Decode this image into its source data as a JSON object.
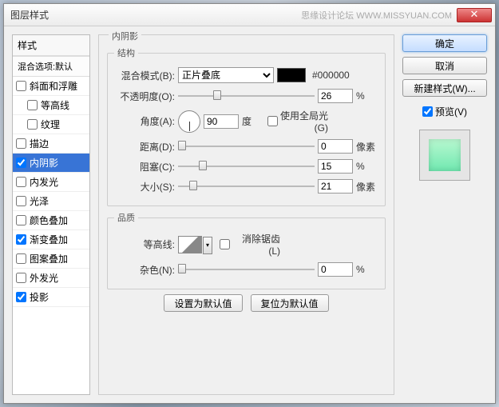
{
  "titlebar": {
    "title": "图层样式",
    "watermark": "思缘设计论坛  WWW.MISSYUAN.COM"
  },
  "sidebar": {
    "header": "样式",
    "blend_defaults": "混合选项:默认",
    "items": [
      {
        "label": "斜面和浮雕",
        "checked": false,
        "indent": false,
        "selected": false
      },
      {
        "label": "等高线",
        "checked": false,
        "indent": true,
        "selected": false
      },
      {
        "label": "纹理",
        "checked": false,
        "indent": true,
        "selected": false
      },
      {
        "label": "描边",
        "checked": false,
        "indent": false,
        "selected": false
      },
      {
        "label": "内阴影",
        "checked": true,
        "indent": false,
        "selected": true
      },
      {
        "label": "内发光",
        "checked": false,
        "indent": false,
        "selected": false
      },
      {
        "label": "光泽",
        "checked": false,
        "indent": false,
        "selected": false
      },
      {
        "label": "颜色叠加",
        "checked": false,
        "indent": false,
        "selected": false
      },
      {
        "label": "渐变叠加",
        "checked": true,
        "indent": false,
        "selected": false
      },
      {
        "label": "图案叠加",
        "checked": false,
        "indent": false,
        "selected": false
      },
      {
        "label": "外发光",
        "checked": false,
        "indent": false,
        "selected": false
      },
      {
        "label": "投影",
        "checked": true,
        "indent": false,
        "selected": false
      }
    ]
  },
  "panel": {
    "title": "内阴影",
    "structure": {
      "legend": "结构",
      "blend_label": "混合模式(B):",
      "blend_value": "正片叠底",
      "color_hex": "#000000",
      "opacity_label": "不透明度(O):",
      "opacity_value": "26",
      "opacity_unit": "%",
      "angle_label": "角度(A):",
      "angle_value": "90",
      "angle_unit": "度",
      "global_light": "使用全局光(G)",
      "distance_label": "距离(D):",
      "distance_value": "0",
      "distance_unit": "像素",
      "choke_label": "阻塞(C):",
      "choke_value": "15",
      "choke_unit": "%",
      "size_label": "大小(S):",
      "size_value": "21",
      "size_unit": "像素"
    },
    "quality": {
      "legend": "品质",
      "contour_label": "等高线:",
      "antialias": "消除锯齿(L)",
      "noise_label": "杂色(N):",
      "noise_value": "0",
      "noise_unit": "%"
    },
    "buttons": {
      "set_default": "设置为默认值",
      "reset_default": "复位为默认值"
    }
  },
  "right": {
    "ok": "确定",
    "cancel": "取消",
    "new_style": "新建样式(W)...",
    "preview_label": "预览(V)"
  }
}
